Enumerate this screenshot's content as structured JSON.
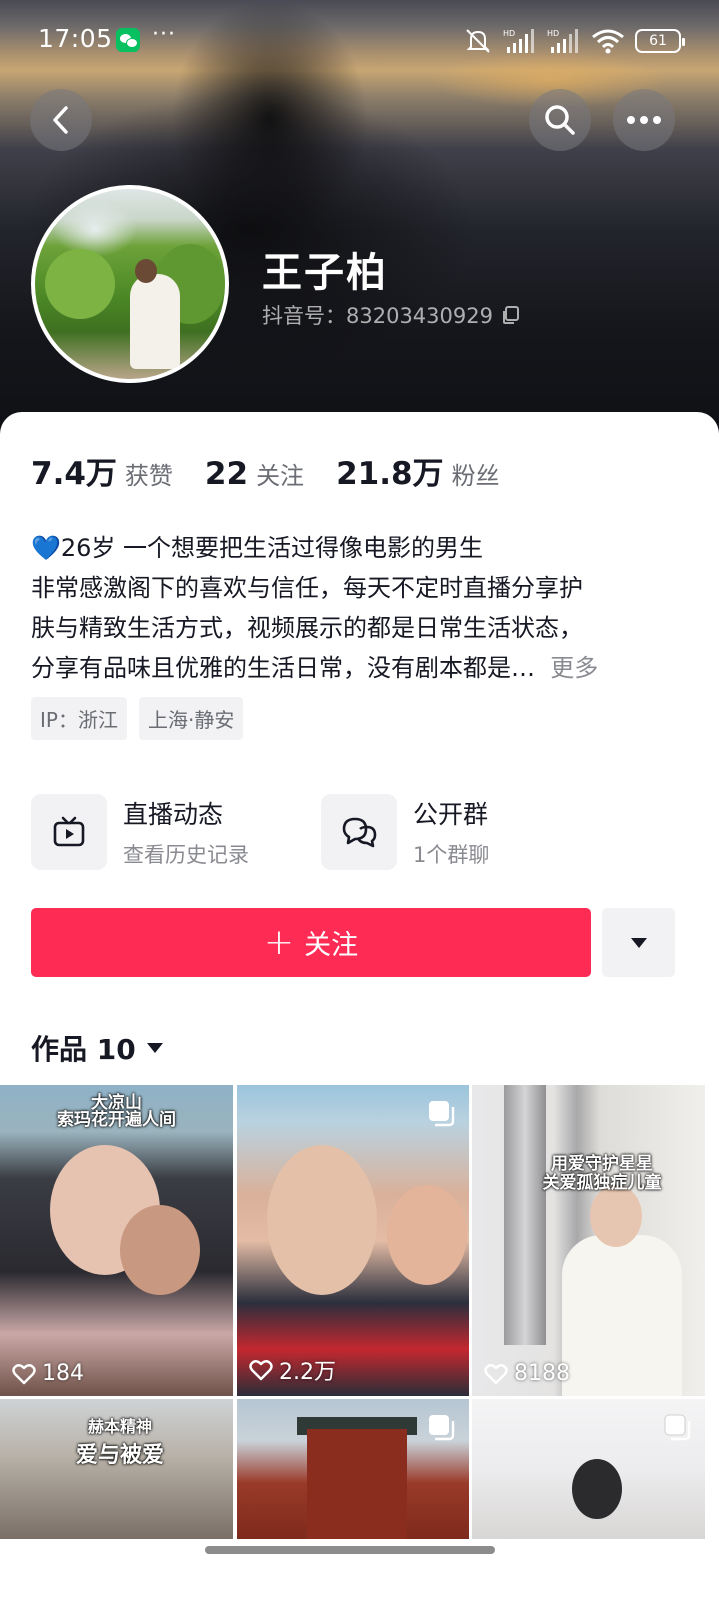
{
  "status_bar": {
    "time": "17:05",
    "dots": "···",
    "battery": "61",
    "network_label": "HD"
  },
  "profile": {
    "name": "王子柏",
    "douyin_id": "抖音号：83203430929"
  },
  "stats": [
    {
      "value": "7.4万",
      "label": "获赞"
    },
    {
      "value": "22",
      "label": "关注"
    },
    {
      "value": "21.8万",
      "label": "粉丝"
    }
  ],
  "bio": {
    "line1_emoji": "💙",
    "line1": "26岁 一个想要把生活过得像电影的男生",
    "line2": "非常感激阁下的喜欢与信任，每天不定时直播分享护",
    "line3": "肤与精致生活方式，视频展示的都是日常生活状态，",
    "line4": "分享有品味且优雅的生活日常，没有剧本都是…",
    "more": "更多"
  },
  "tags": {
    "ip": "IP：浙江",
    "location": "上海·静安"
  },
  "entries": {
    "live": {
      "title": "直播动态",
      "sub": "查看历史记录"
    },
    "group": {
      "title": "公开群",
      "sub": "1个群聊"
    }
  },
  "actions": {
    "follow_label": "关注",
    "follow_plus": "+"
  },
  "works": {
    "label": "作品 10"
  },
  "videos": [
    {
      "caption_a": "大凉山",
      "caption_b": "索玛花开遍人间",
      "likes": "184"
    },
    {
      "likes": "2.2万"
    },
    {
      "caption_a": "用爱守护星星",
      "caption_b": "关爱孤独症儿童",
      "likes": "8188"
    },
    {
      "caption_a": "赫本精神",
      "caption_b": "爱与被爱"
    },
    {},
    {}
  ],
  "colors": {
    "accent": "#fe2c55",
    "text_primary": "#161823",
    "text_secondary": "#8a8b91"
  }
}
